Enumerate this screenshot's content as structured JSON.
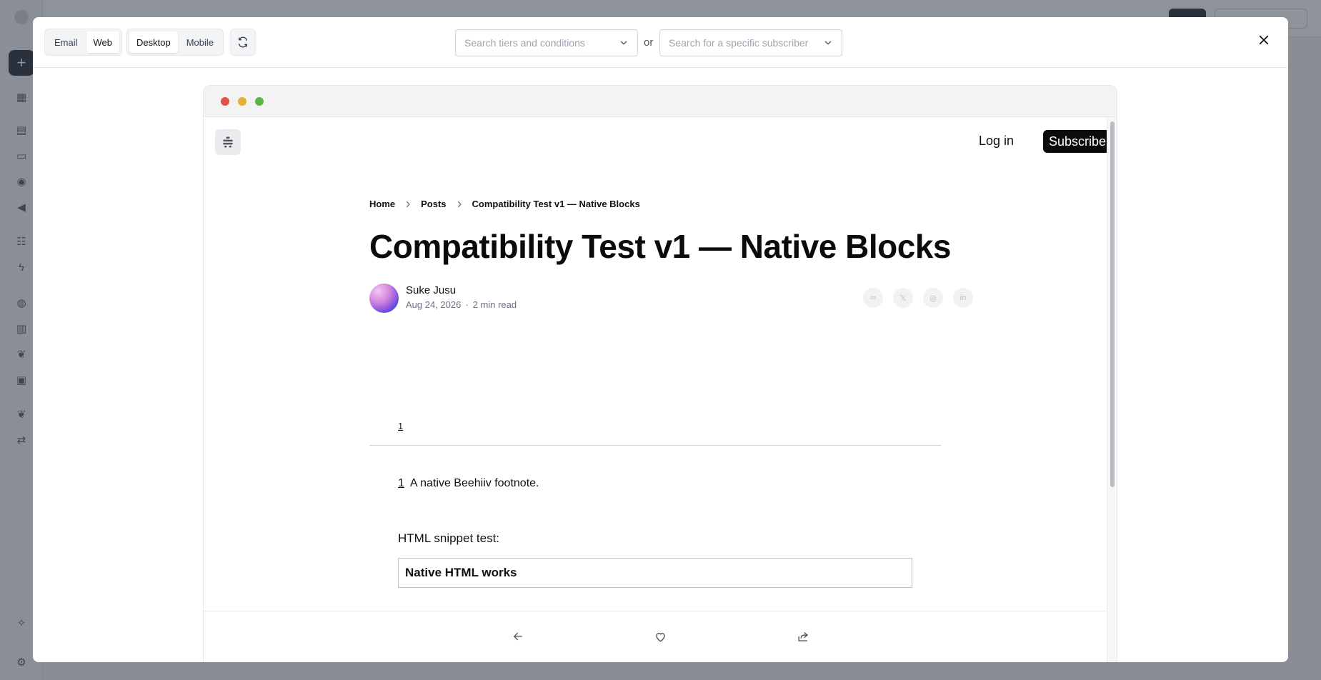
{
  "header": {
    "channel_tabs": [
      {
        "label": "Email",
        "active": false
      },
      {
        "label": "Web",
        "active": true
      }
    ],
    "device_tabs": [
      {
        "label": "Desktop",
        "active": true
      },
      {
        "label": "Mobile",
        "active": false
      }
    ],
    "tiers_select": {
      "placeholder": "Search tiers and conditions"
    },
    "or_label": "or",
    "subscriber_select": {
      "placeholder": "Search for a specific subscriber"
    }
  },
  "site": {
    "login_label": "Log in",
    "subscribe_label": "Subscribe"
  },
  "breadcrumb": [
    "Home",
    "Posts",
    "Compatibility Test v1 — Native Blocks"
  ],
  "post": {
    "title": "Compatibility Test v1 — Native Blocks",
    "author": "Suke Jusu",
    "date": "Aug 24, 2026",
    "separator": "·",
    "read_time": "2 min read",
    "footnote_ref": "1",
    "footnote_number": "1",
    "footnote_text": "A native Beehiiv footnote.",
    "snippet_label": "HTML snippet test:",
    "snippet_content": "Native HTML works"
  },
  "share_icons": [
    {
      "name": "threads-icon",
      "glyph": "∞"
    },
    {
      "name": "x-icon",
      "glyph": "𝕏"
    },
    {
      "name": "share-link-icon",
      "glyph": "◎"
    },
    {
      "name": "linkedin-icon",
      "glyph": "in"
    }
  ],
  "colors": {
    "accent": "#0b0b0b",
    "traffic_red": "#e0524a",
    "traffic_yellow": "#e4b135",
    "traffic_green": "#5bb543"
  }
}
